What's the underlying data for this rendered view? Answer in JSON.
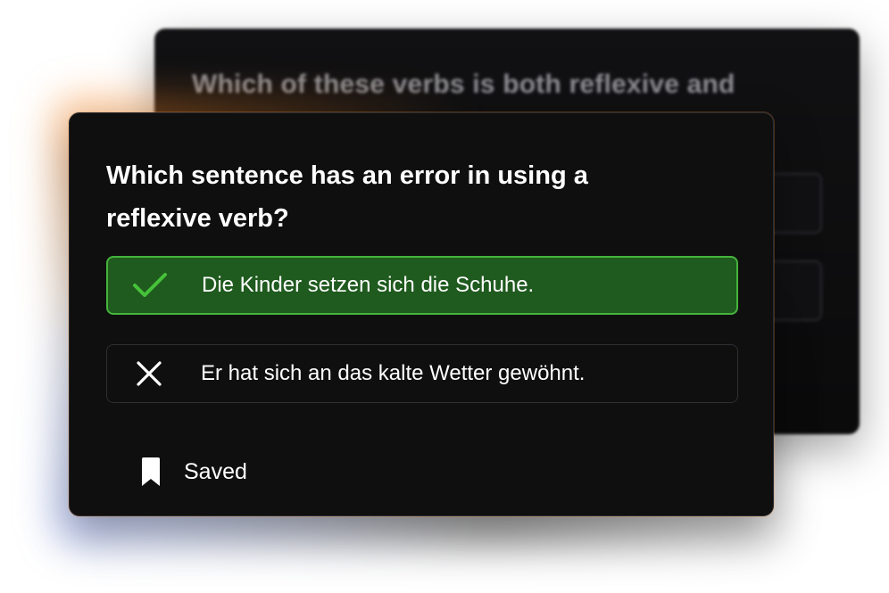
{
  "background_card": {
    "title": "Which of these verbs is both reflexive and"
  },
  "quiz": {
    "question": "Which sentence has an error in using a reflexive verb?",
    "options": [
      {
        "label": "Die Kinder setzen sich die Schuhe.",
        "icon": "check-icon",
        "state": "correct"
      },
      {
        "label": "Er hat sich an das kalte Wetter gewöhnt.",
        "icon": "x-icon",
        "state": "incorrect"
      }
    ],
    "saved": {
      "label": "Saved",
      "icon": "bookmark-icon"
    }
  },
  "colors": {
    "card_background": "#0f0f10",
    "correct_fill": "#1f5a1e",
    "correct_border": "#45b33c",
    "check_green": "#46c23a",
    "text": "#ffffff"
  }
}
